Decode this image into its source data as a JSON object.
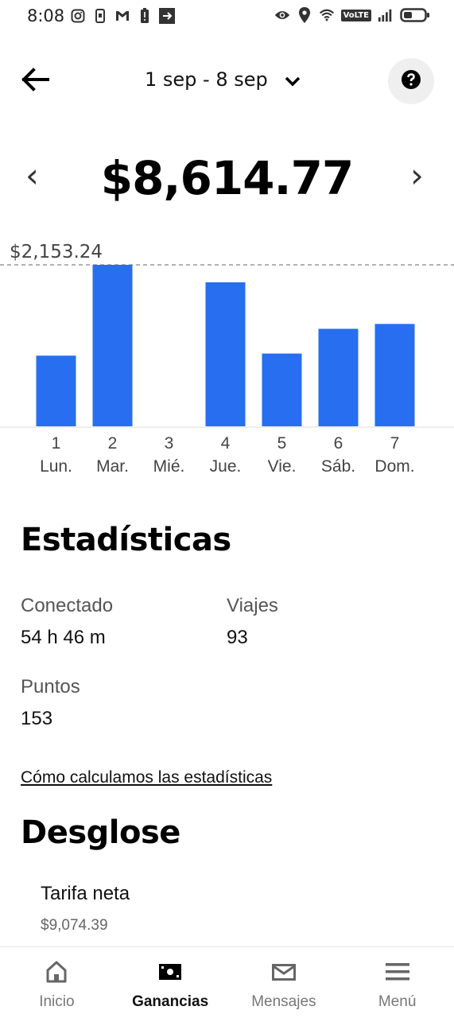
{
  "status_bar": {
    "time": "8:08",
    "network_badge": "VoLTE",
    "icons_left": [
      "instagram-icon",
      "phone-icon",
      "gmail-icon",
      "battery-alert-icon",
      "cast-icon"
    ],
    "icons_right": [
      "eye-icon",
      "location-icon",
      "wifi-icon",
      "volte-icon",
      "signal-icon",
      "battery-icon"
    ]
  },
  "header": {
    "date_range": "1 sep - 8 sep",
    "back_icon": "arrow-left-icon",
    "dropdown_icon": "chevron-down-icon",
    "help_icon": "help-icon"
  },
  "summary": {
    "total": "$8,614.77",
    "prev": "‹",
    "next": "›"
  },
  "chart_data": {
    "type": "bar",
    "max_label": "$2,153.24",
    "max_value": 2153.24,
    "categories": [
      "1",
      "2",
      "3",
      "4",
      "5",
      "6",
      "7"
    ],
    "day_names": [
      "Lun.",
      "Mar.",
      "Mié.",
      "Jue.",
      "Vie.",
      "Sáb.",
      "Dom."
    ],
    "values": [
      942,
      2153.24,
      0,
      1920,
      970,
      1300,
      1365
    ],
    "bar_color": "#276EF1"
  },
  "stats": {
    "title": "Estadísticas",
    "online_label": "Conectado",
    "online_value": "54 h 46 m",
    "trips_label": "Viajes",
    "trips_value": "93",
    "points_label": "Puntos",
    "points_value": "153",
    "link": "Cómo calculamos las estadísticas"
  },
  "breakdown": {
    "title": "Desglose",
    "item_title": "Tarifa neta",
    "item_value": "$9,074.39"
  },
  "bottom_nav": {
    "items": [
      {
        "label": "Inicio",
        "icon": "home-icon"
      },
      {
        "label": "Ganancias",
        "icon": "earnings-icon"
      },
      {
        "label": "Mensajes",
        "icon": "mail-icon"
      },
      {
        "label": "Menú",
        "icon": "menu-icon"
      }
    ],
    "active_index": 1
  }
}
